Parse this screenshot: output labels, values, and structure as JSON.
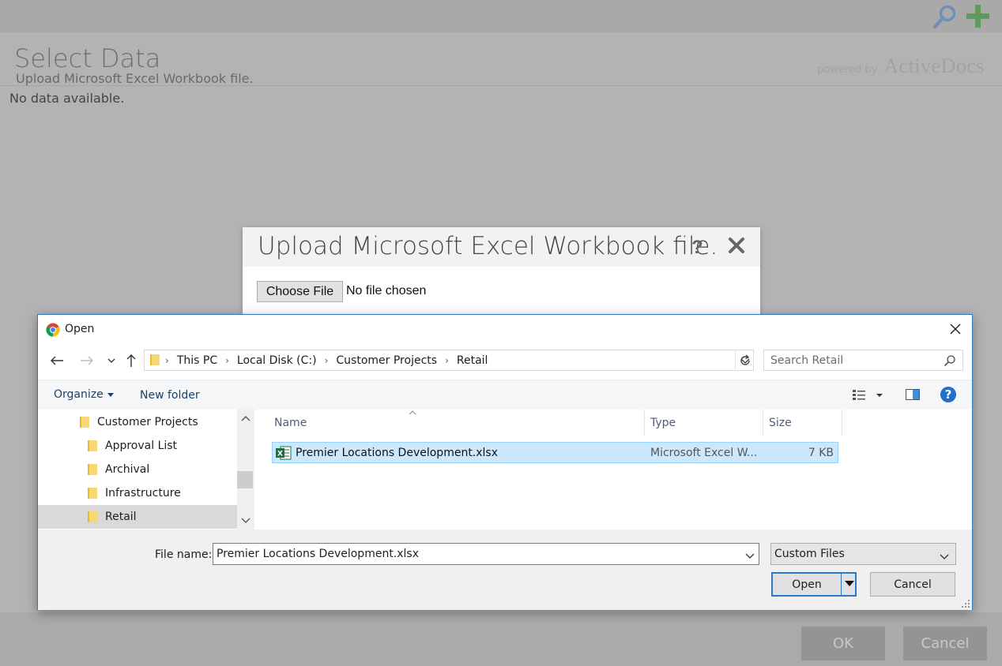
{
  "background": {
    "title": "Select Data",
    "subtitle": "Upload Microsoft Excel Workbook file.",
    "powered_by": "powered by",
    "brand": "ActiveDocs",
    "no_data": "No data available.",
    "ok_label": "OK",
    "cancel_label": "Cancel"
  },
  "upload_modal": {
    "title": "Upload Microsoft Excel Workbook file.",
    "help": "?",
    "choose_file": "Choose File",
    "no_file": "No file chosen"
  },
  "open_dialog": {
    "title": "Open",
    "breadcrumbs": [
      "This PC",
      "Local Disk (C:)",
      "Customer Projects",
      "Retail"
    ],
    "search_placeholder": "Search Retail",
    "organize": "Organize",
    "new_folder": "New folder",
    "tree": [
      {
        "label": "Customer Projects",
        "selected": false
      },
      {
        "label": "Approval List",
        "selected": false
      },
      {
        "label": "Archival",
        "selected": false
      },
      {
        "label": "Infrastructure",
        "selected": false
      },
      {
        "label": "Retail",
        "selected": true
      }
    ],
    "columns": [
      "Name",
      "Type",
      "Size"
    ],
    "files": [
      {
        "name": "Premier Locations Development.xlsx",
        "type": "Microsoft Excel W...",
        "size": "7 KB"
      }
    ],
    "file_name_label": "File name:",
    "file_name_value": "Premier Locations Development.xlsx",
    "file_type": "Custom Files",
    "open_label": "Open",
    "cancel_label": "Cancel"
  },
  "colors": {
    "accent": "#2b78c4",
    "selection": "#cce8ff",
    "search_icon": "#4a90d9",
    "plus_icon": "#5cb85c",
    "excel_green": "#1d6f42"
  }
}
